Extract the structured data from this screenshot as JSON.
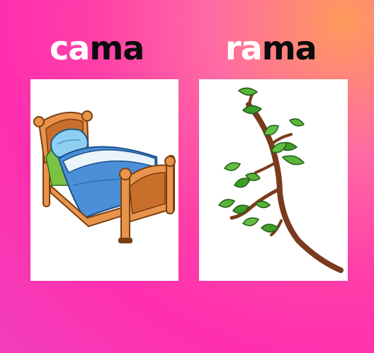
{
  "words": {
    "left": {
      "prefix": "ca",
      "suffix": "ma"
    },
    "right": {
      "prefix": "ra",
      "suffix": "ma"
    }
  },
  "colors": {
    "prefix_text": "#ffffff",
    "suffix_text": "#0c0c0c",
    "background_primary": "#ff3fa8",
    "background_accent": "#ff9a5c",
    "card_background": "#ffffff"
  },
  "images": [
    {
      "name": "bed-illustration"
    },
    {
      "name": "branch-illustration"
    }
  ]
}
